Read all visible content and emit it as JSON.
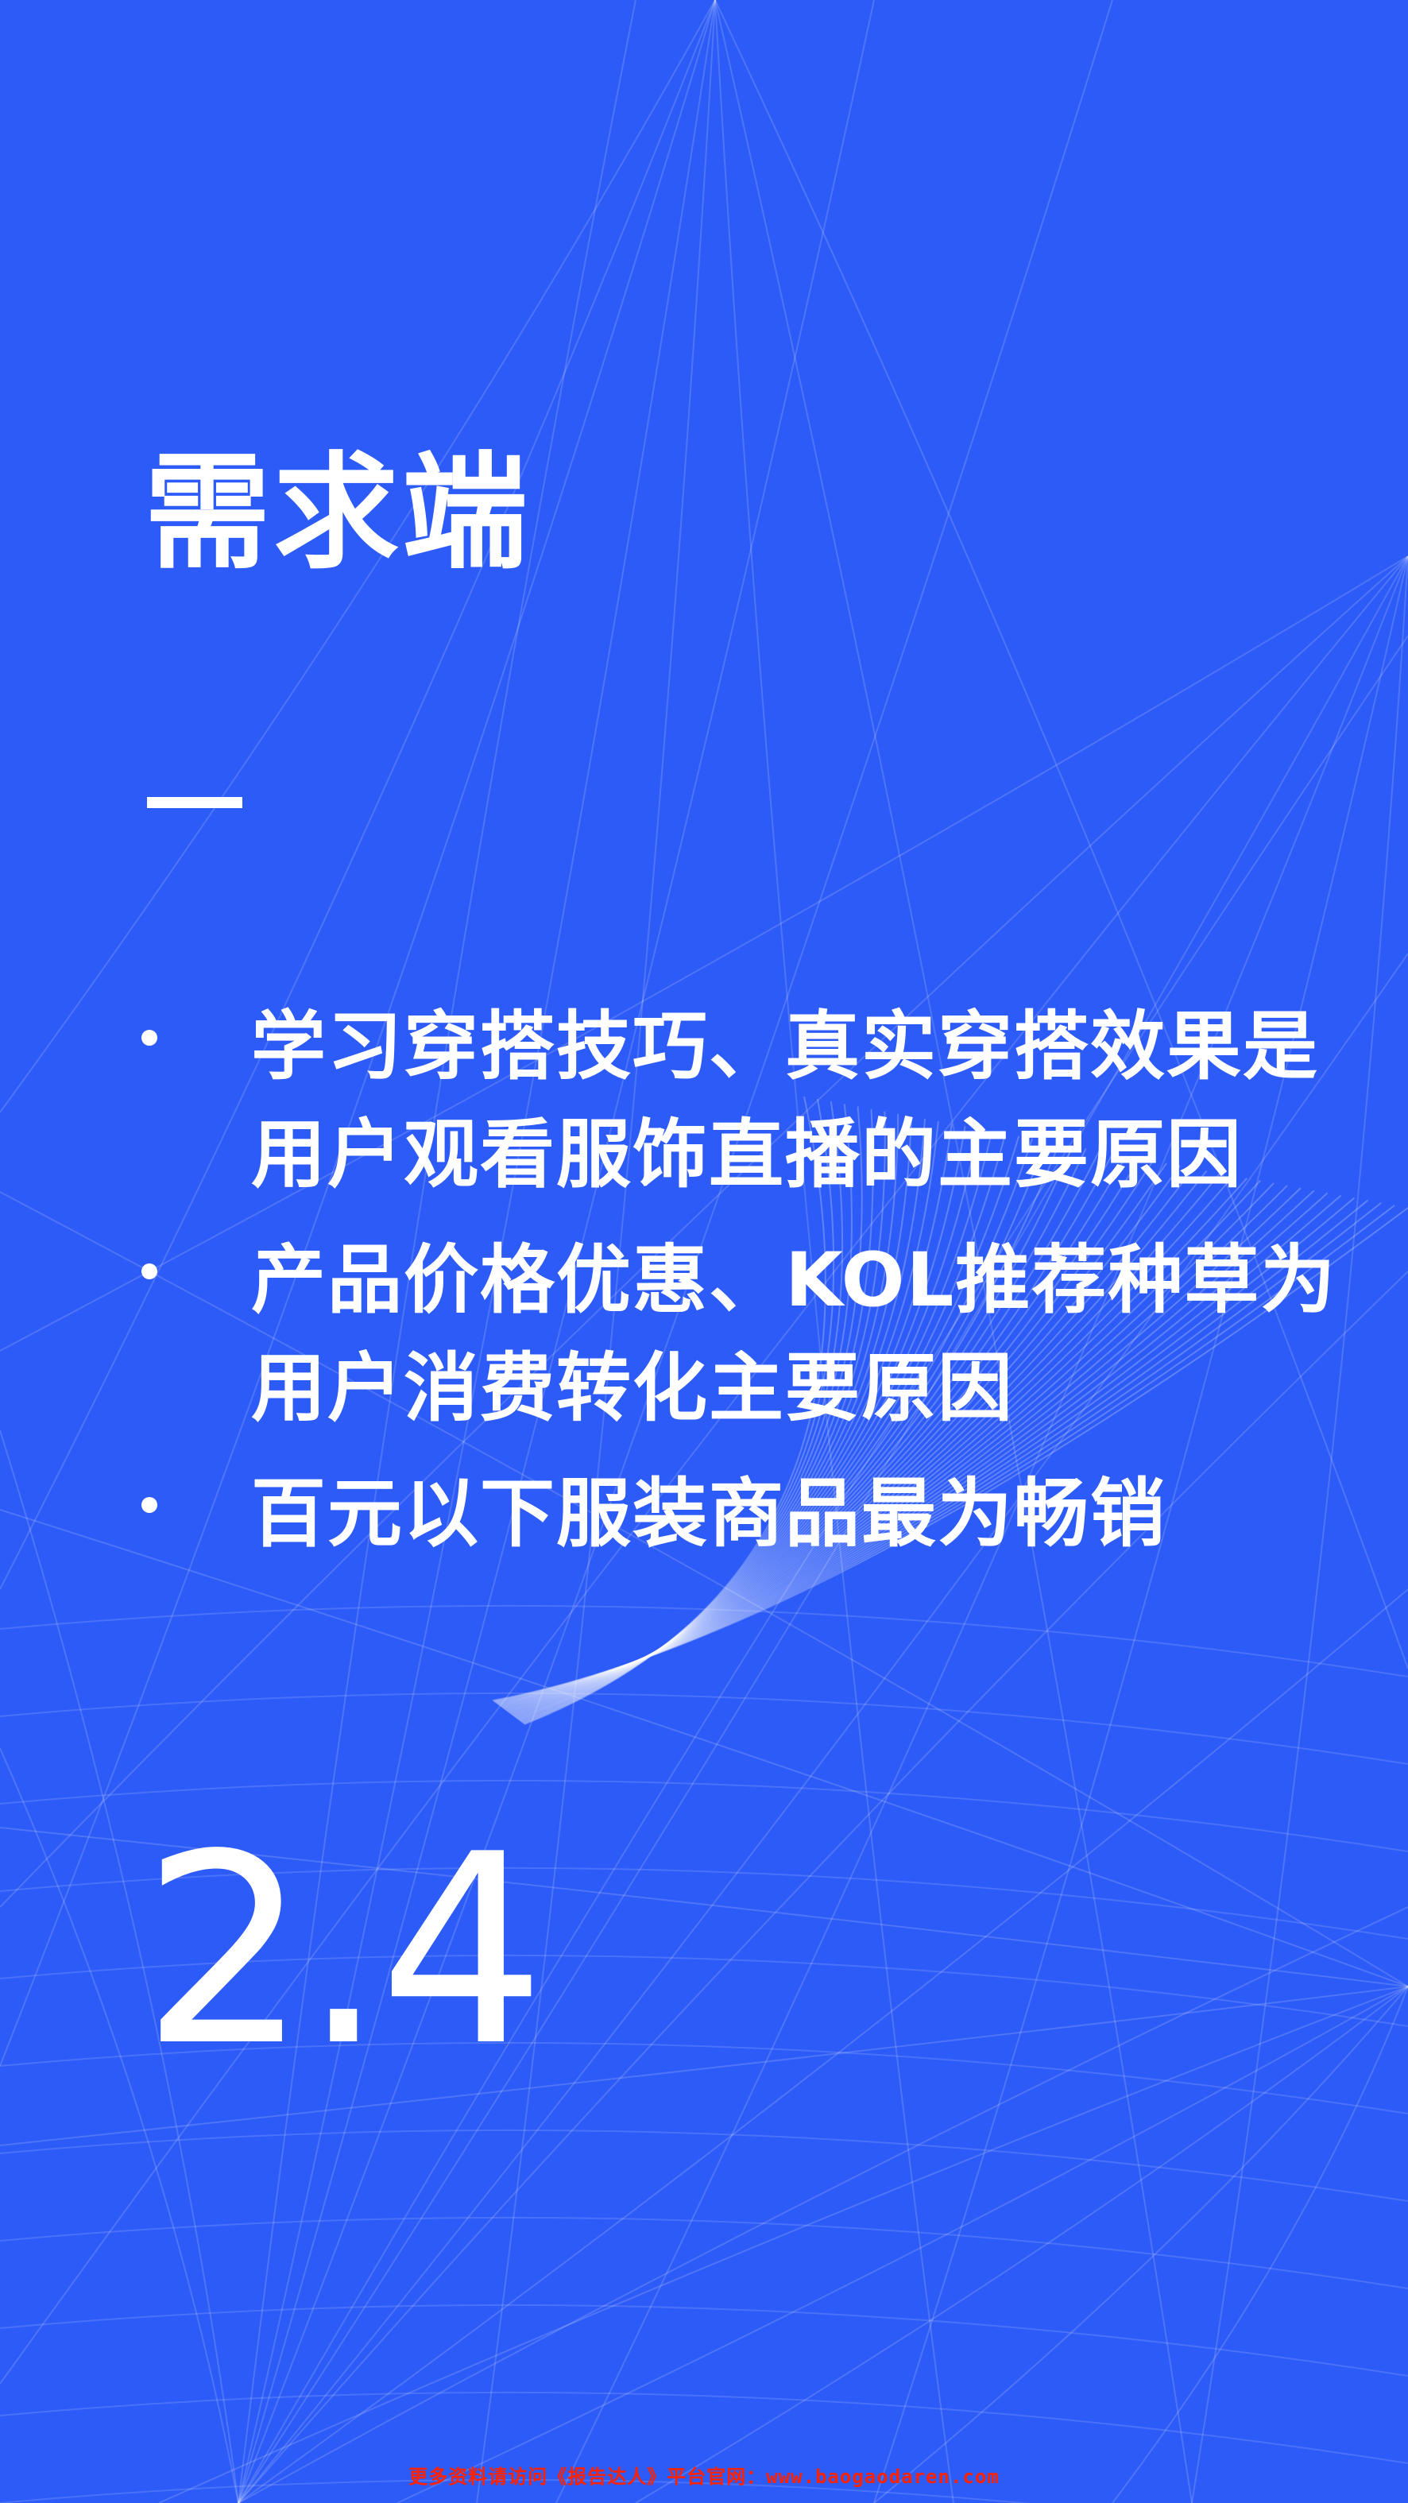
{
  "slide": {
    "section_title": "需求端",
    "section_number": "2.4",
    "bullets": [
      {
        "text": "学习穿搭技巧、真实穿搭效果是用户观看服饰直播的主要原因"
      },
      {
        "text": "产品价格优惠、KOL推荐种草为用户消费转化主要原因"
      },
      {
        "text": "百元以下服装商品最为畅销"
      }
    ]
  },
  "footer": {
    "text": "更多资料请访问《报告达人》平台官网：www.baogaodaren.com"
  },
  "colors": {
    "background": "#2d5bf7",
    "text": "#ffffff",
    "footer_text": "#ff2200"
  }
}
